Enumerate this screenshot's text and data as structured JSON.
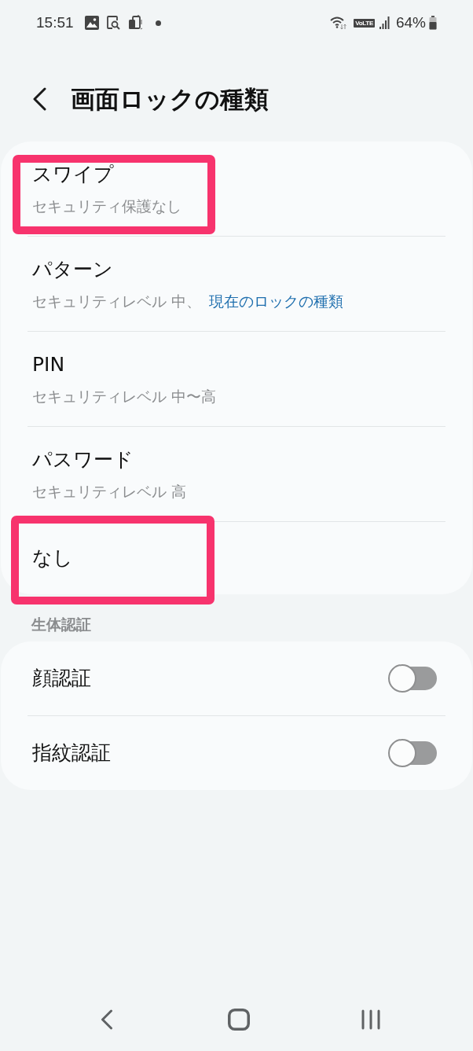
{
  "status_bar": {
    "time": "15:51",
    "network_badge": "VoLTE",
    "battery": "64%"
  },
  "header": {
    "title": "画面ロックの種類"
  },
  "lock_types": [
    {
      "title": "スワイプ",
      "subtitle": "セキュリティ保護なし",
      "highlighted": true
    },
    {
      "title": "パターン",
      "subtitle": "セキュリティレベル 中、",
      "current_label": "現在のロックの種類",
      "highlighted": false
    },
    {
      "title": "PIN",
      "subtitle": "セキュリティレベル 中〜高",
      "highlighted": false
    },
    {
      "title": "パスワード",
      "subtitle": "セキュリティレベル 高",
      "highlighted": false
    },
    {
      "title": "なし",
      "highlighted": true
    }
  ],
  "biometrics": {
    "heading": "生体認証",
    "items": [
      {
        "label": "顔認証",
        "on": false
      },
      {
        "label": "指紋認証",
        "on": false
      }
    ]
  }
}
